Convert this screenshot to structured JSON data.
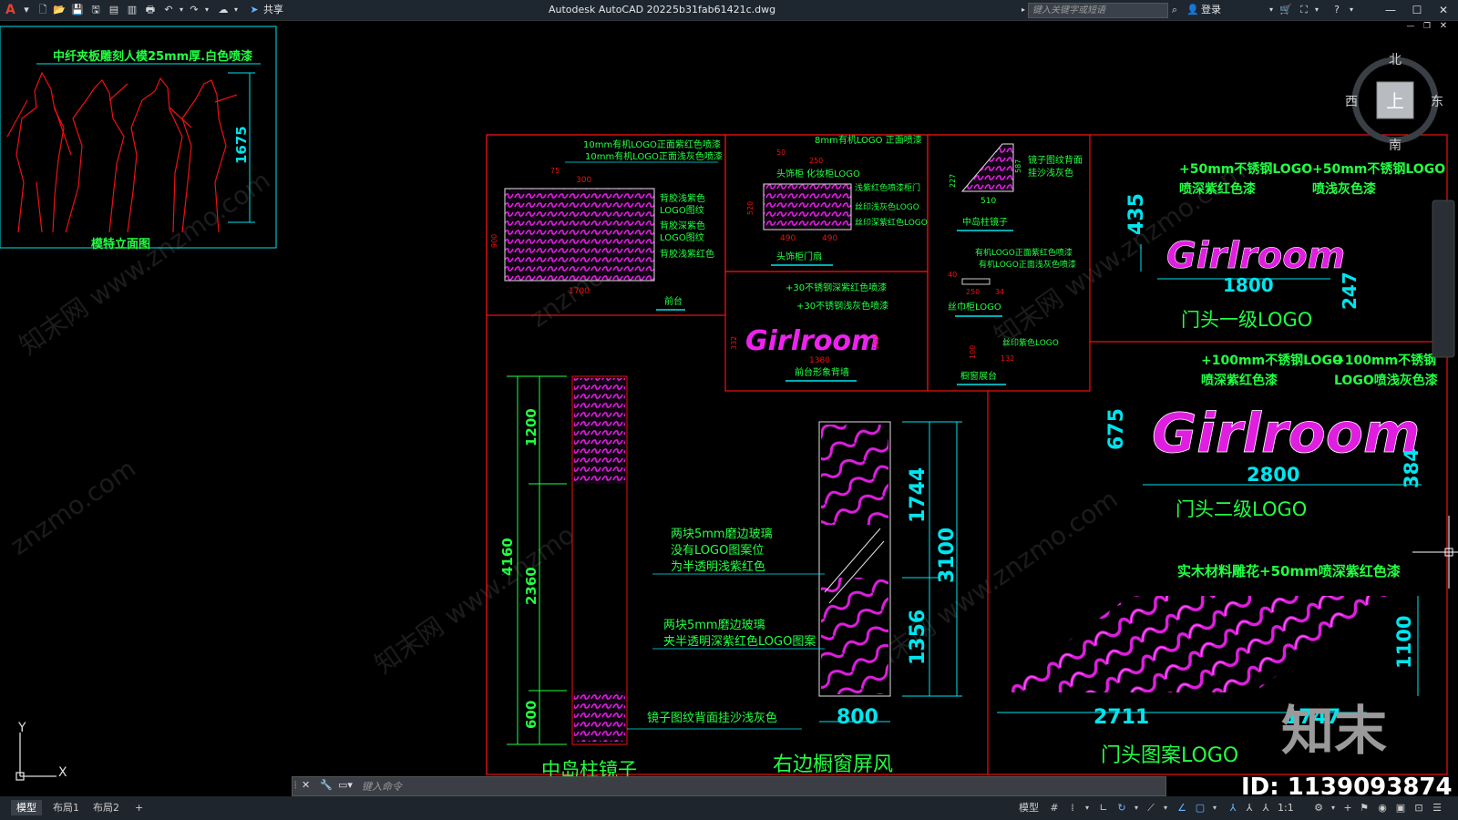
{
  "app": {
    "logo": "A",
    "title": "Autodesk AutoCAD 2022",
    "filename": "5b31fab61421c.dwg",
    "share_label": "共享",
    "search_placeholder": "键入关键字或短语",
    "login_label": "登录"
  },
  "viewcube": {
    "north": "北",
    "south": "南",
    "east": "东",
    "west": "西",
    "face": "上"
  },
  "drawing": {
    "t1": "中纤夹板雕刻人模25mm厚.白色喷漆",
    "t2": "1675",
    "t3": "模特立面图",
    "t4": "10mm有机LOGO正面紫红色喷漆",
    "t5": "10mm有机LOGO正面浅灰色喷漆",
    "t6": "75",
    "t7": "300",
    "t8": "背胶浅紫色",
    "t9": "LOGO图纹",
    "t10": "背胶深紫色",
    "t11": "LOGO图纹",
    "t12": "背胶浅紫红色",
    "t13": "900",
    "t14": "1700",
    "t15": "前台",
    "t16": "8mm有机LOGO 正面喷漆",
    "t17": "50",
    "t18": "250",
    "t19": "头饰柜 化妆柜LOGO",
    "t20": "浅紫红色喷漆柜门",
    "t21": "丝印浅灰色LOGO",
    "t22": "丝印深紫红色LOGO",
    "t23": "520",
    "t24": "490",
    "t25": "490",
    "t26": "头饰柜门扇",
    "t27": "227",
    "t28": "587",
    "t29": "镜子图纹背面",
    "t30": "挂沙浅灰色",
    "t31": "510",
    "t32": "中岛柱镜子",
    "t33": "有机LOGO正面紫红色喷漆",
    "t34": "有机LOGO正面浅灰色喷漆",
    "t35": "40",
    "t36": "250",
    "t37": "34",
    "t38": "丝巾柜LOGO",
    "t39": "+30不锈钢深紫红色喷漆",
    "t40": "+30不锈钢浅灰色喷漆",
    "t41": "332",
    "t42": "1380",
    "t43": "100",
    "t44": "前台形象背墙",
    "t45": "100",
    "t46": "132",
    "t47": "丝印紫色LOGO",
    "t48": "橱窗展台",
    "t49": "+50mm不锈钢LOGO",
    "t50": "喷深紫红色漆",
    "t51": "+50mm不锈钢LOGO",
    "t52": "喷浅灰色漆",
    "t53": "435",
    "t54": "1800",
    "t55": "247",
    "t56": "门头一级LOGO",
    "t57": "+100mm不锈钢LOGO",
    "t58": "喷深紫红色漆",
    "t59": "+100mm不锈钢",
    "t60": "LOGO喷浅灰色漆",
    "t61": "675",
    "t62": "2800",
    "t63": "384",
    "t64": "门头二级LOGO",
    "t65": "实木材料雕花+50mm喷深紫红色漆",
    "t66": "1100",
    "t67": "2711",
    "t68": "1747",
    "t69": "门头图案LOGO",
    "t70": "4160",
    "t71": "1200",
    "t72": "2360",
    "t73": "600",
    "t74": "两块5mm磨边玻璃",
    "t75": "没有LOGO图案位",
    "t76": "为半透明浅紫红色",
    "t77": "两块5mm磨边玻璃",
    "t78": "夹半透明深紫红色LOGO图案",
    "t79": "镜子图纹背面挂沙浅灰色",
    "t80": "1744",
    "t81": "3100",
    "t82": "1356",
    "t83": "800",
    "t84": "中岛柱镜子",
    "t85": "右边橱窗屏风",
    "logo_text": "Girlroom",
    "ucs_x": "X",
    "ucs_y": "Y"
  },
  "watermark": {
    "brand": "知末",
    "id": "ID: 1139093874",
    "wm_cn": "知末网 www.znzmo.com",
    "wm_en": "znzmo.com"
  },
  "command": {
    "placeholder": "键入命令"
  },
  "layout_tabs": [
    "模型",
    "布局1",
    "布局2",
    "+"
  ],
  "status": {
    "model_label": "模型",
    "scale": "1:1"
  },
  "colors": {
    "green": "#22ff44",
    "cyan": "#00e5ee",
    "red": "#ee1111",
    "magenta": "#ee22ee",
    "white": "#ffffff",
    "canvas_bg": "#000000",
    "titlebar": "#1e2630"
  }
}
